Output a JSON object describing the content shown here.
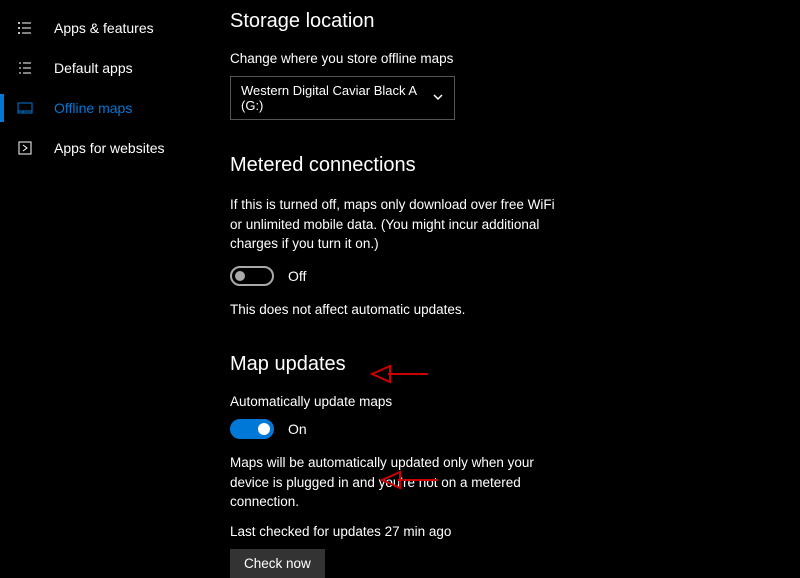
{
  "sidebar": {
    "items": [
      {
        "label": "Apps & features",
        "icon": "apps-features-icon",
        "selected": false
      },
      {
        "label": "Default apps",
        "icon": "default-apps-icon",
        "selected": false
      },
      {
        "label": "Offline maps",
        "icon": "offline-maps-icon",
        "selected": true
      },
      {
        "label": "Apps for websites",
        "icon": "apps-websites-icon",
        "selected": false
      }
    ]
  },
  "storage": {
    "title": "Storage location",
    "caption": "Change where you store offline maps",
    "selected": "Western Digital Caviar Black A (G:)"
  },
  "metered": {
    "title": "Metered connections",
    "desc": "If this is turned off, maps only download over free WiFi or unlimited mobile data. (You might incur additional charges if you turn it on.)",
    "toggle_state": "Off",
    "footer": "This does not affect automatic updates."
  },
  "updates": {
    "title": "Map updates",
    "caption": "Automatically update maps",
    "toggle_state": "On",
    "desc": "Maps will be automatically updated only when your device is plugged in and you're not on a metered connection.",
    "last_checked": "Last checked for updates 27 min ago",
    "check_button": "Check now"
  }
}
